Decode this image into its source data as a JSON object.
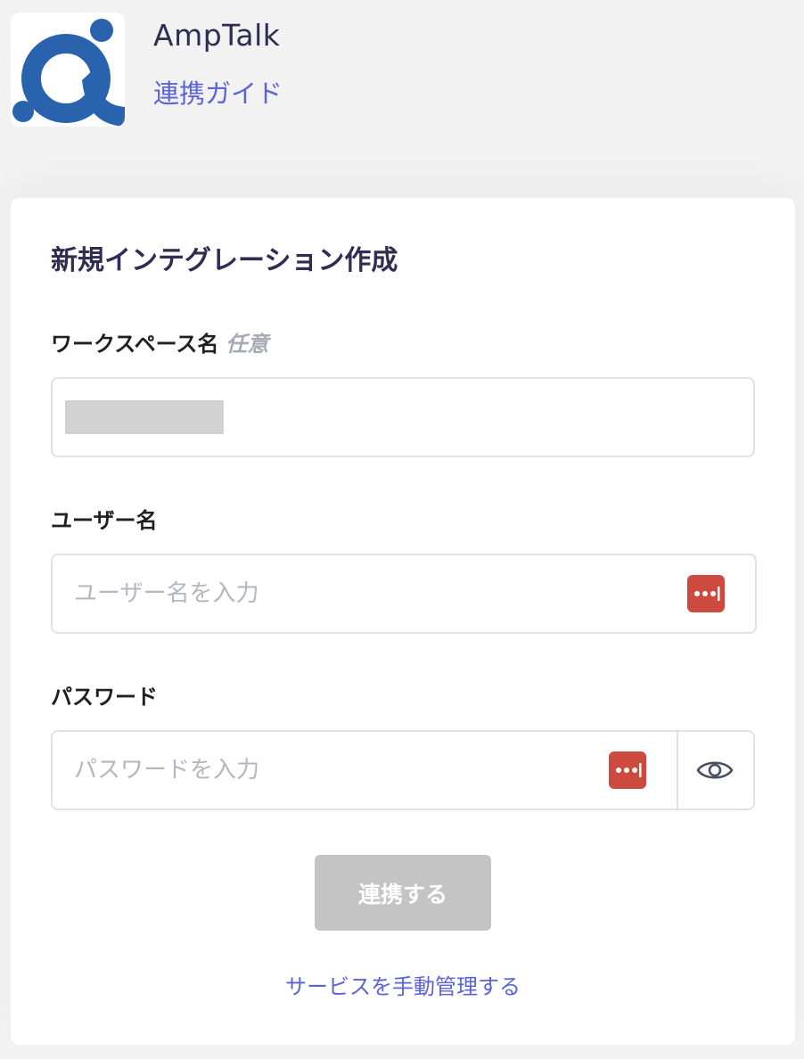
{
  "app": {
    "name": "AmpTalk",
    "guide_link": "連携ガイド",
    "brand_color": "#2a63ad",
    "link_color": "#5a63d8"
  },
  "form": {
    "title": "新規インテグレーション作成",
    "workspace": {
      "label": "ワークスペース名",
      "optional_label": "任意",
      "value": ""
    },
    "username": {
      "label": "ユーザー名",
      "placeholder": "ユーザー名を入力",
      "value": ""
    },
    "password": {
      "label": "パスワード",
      "placeholder": "パスワードを入力",
      "value": ""
    },
    "submit_label": "連携する",
    "manual_link": "サービスを手動管理する"
  },
  "icons": {
    "password_manager": "password-manager-icon",
    "show_password": "eye-icon"
  },
  "colors": {
    "password_manager_icon": "#cc4a3e",
    "submit_disabled": "#c4c4c4"
  }
}
